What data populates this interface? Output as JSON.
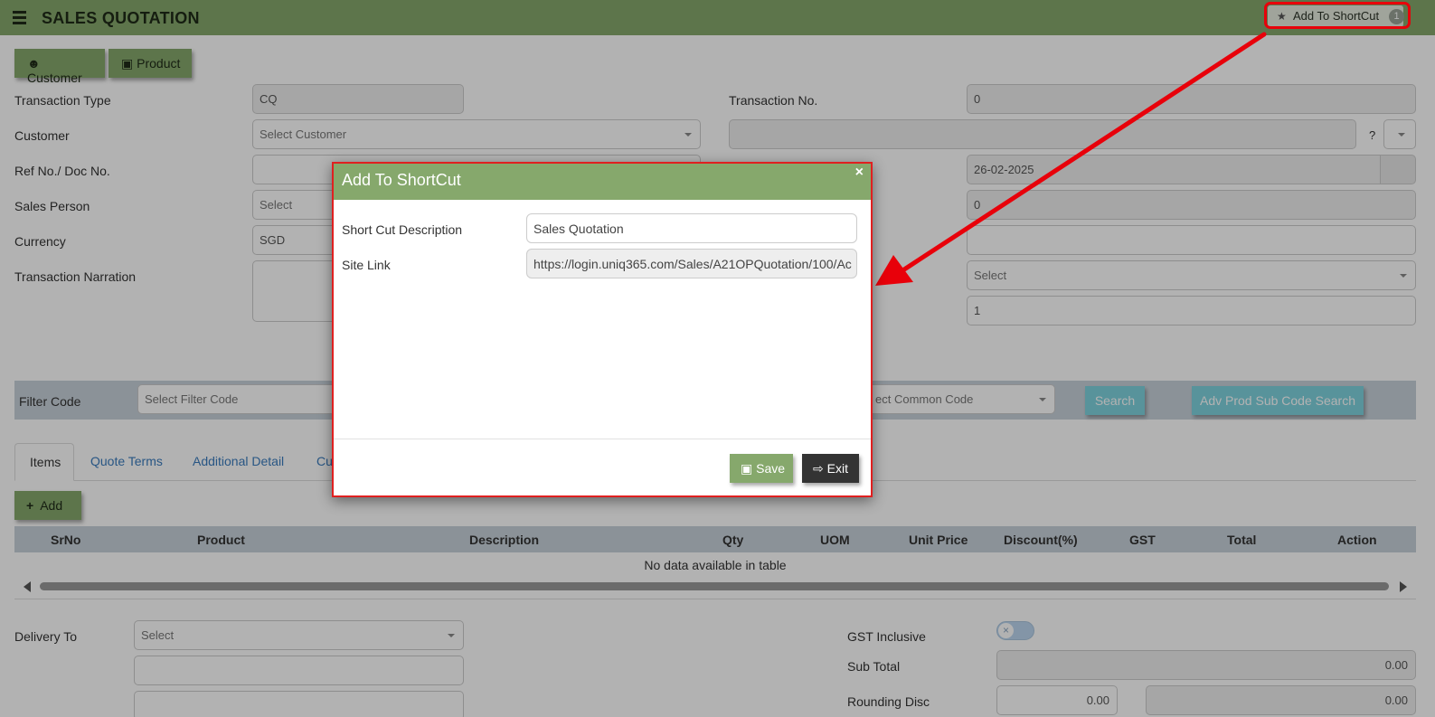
{
  "header": {
    "title": "SALES QUOTATION",
    "shortcut_label": "Add To ShortCut",
    "shortcut_count": "1"
  },
  "toolbar": {
    "customer_label": "Customer",
    "product_label": "Product"
  },
  "form": {
    "transaction_type_label": "Transaction Type",
    "transaction_type_value": "CQ",
    "customer_label": "Customer",
    "customer_placeholder": "Select Customer",
    "ref_label": "Ref No./ Doc No.",
    "sales_person_label": "Sales Person",
    "sales_person_placeholder": "Select",
    "currency_label": "Currency",
    "currency_value": "SGD",
    "narration_label": "Transaction Narration",
    "transaction_no_label": "Transaction No.",
    "transaction_no_value": "0",
    "help_mark": "?",
    "date_value": "26-02-2025",
    "right_value_zero": "0",
    "right_select_placeholder": "Select",
    "right_value_one": "1"
  },
  "filter": {
    "filter_code_label": "Filter Code",
    "filter_code_placeholder": "Select Filter Code",
    "common_code_placeholder": "ect Common Code",
    "search_label": "Search",
    "adv_search_label": "Adv Prod Sub Code Search"
  },
  "tabs": [
    {
      "label": "Items"
    },
    {
      "label": "Quote Terms"
    },
    {
      "label": "Additional Detail"
    },
    {
      "label": "Cu"
    }
  ],
  "items": {
    "add_label": "Add",
    "columns": [
      "SrNo",
      "Product",
      "Description",
      "Qty",
      "UOM",
      "Unit Price",
      "Discount(%)",
      "GST",
      "Total",
      "Action"
    ],
    "empty_text": "No data available in table"
  },
  "footer": {
    "delivery_label": "Delivery To",
    "delivery_placeholder": "Select",
    "gst_inclusive_label": "GST Inclusive",
    "gst_inclusive_on": false,
    "sub_total_label": "Sub Total",
    "sub_total_value": "0.00",
    "rounding_label": "Rounding Disc",
    "rounding_value_1": "0.00",
    "rounding_value_2": "0.00"
  },
  "modal": {
    "title": "Add To ShortCut",
    "desc_label": "Short Cut Description",
    "desc_value": "Sales Quotation",
    "link_label": "Site Link",
    "link_value": "https://login.uniq365.com/Sales/A21OPQuotation/100/Ac",
    "save_label": "Save",
    "exit_label": "Exit"
  },
  "colors": {
    "header_green": "#86a86c",
    "teal_button": "#7fd3df",
    "highlight_red": "#e8000a"
  }
}
